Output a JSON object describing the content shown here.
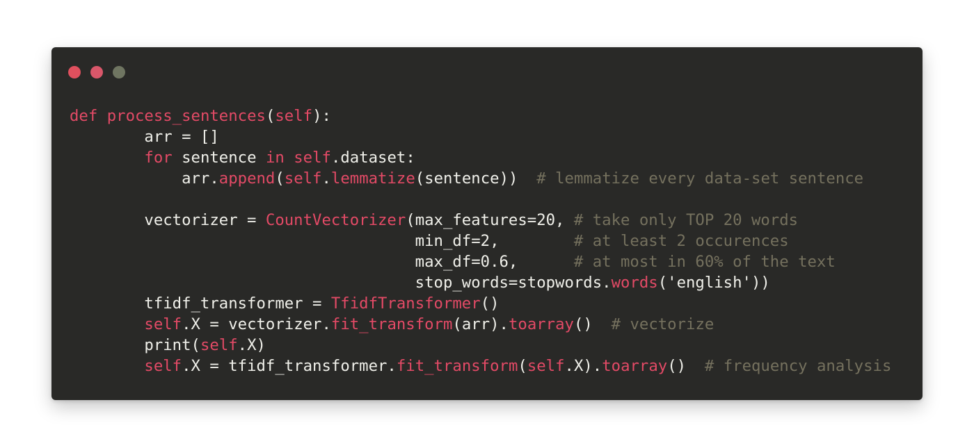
{
  "window": {
    "traffic_lights": [
      {
        "name": "close",
        "color": "#e0505e"
      },
      {
        "name": "minimize",
        "color": "#d9576a"
      },
      {
        "name": "maximize",
        "color": "#6f7561"
      }
    ]
  },
  "colors": {
    "background": "#292927",
    "plain": "#f0f0ea",
    "keyword": "#e34a66",
    "comment": "#75715e"
  },
  "code": {
    "lines": [
      [
        {
          "t": "def",
          "c": "keyword"
        },
        {
          "t": " ",
          "c": "plain"
        },
        {
          "t": "process_sentences",
          "c": "keyword"
        },
        {
          "t": "(",
          "c": "plain"
        },
        {
          "t": "self",
          "c": "keyword"
        },
        {
          "t": "):",
          "c": "plain"
        }
      ],
      [
        {
          "t": "        arr = []",
          "c": "plain"
        }
      ],
      [
        {
          "t": "        ",
          "c": "plain"
        },
        {
          "t": "for",
          "c": "keyword"
        },
        {
          "t": " sentence ",
          "c": "plain"
        },
        {
          "t": "in",
          "c": "keyword"
        },
        {
          "t": " ",
          "c": "plain"
        },
        {
          "t": "self",
          "c": "keyword"
        },
        {
          "t": ".dataset:",
          "c": "plain"
        }
      ],
      [
        {
          "t": "            arr.",
          "c": "plain"
        },
        {
          "t": "append",
          "c": "keyword"
        },
        {
          "t": "(",
          "c": "plain"
        },
        {
          "t": "self",
          "c": "keyword"
        },
        {
          "t": ".",
          "c": "plain"
        },
        {
          "t": "lemmatize",
          "c": "keyword"
        },
        {
          "t": "(sentence))  ",
          "c": "plain"
        },
        {
          "t": "# lemmatize every data-set sentence",
          "c": "comment"
        }
      ],
      [],
      [
        {
          "t": "        vectorizer = ",
          "c": "plain"
        },
        {
          "t": "CountVectorizer",
          "c": "keyword"
        },
        {
          "t": "(max_features=20, ",
          "c": "plain"
        },
        {
          "t": "# take only TOP 20 words",
          "c": "comment"
        }
      ],
      [
        {
          "t": "                                     min_df=2,        ",
          "c": "plain"
        },
        {
          "t": "# at least 2 occurences",
          "c": "comment"
        }
      ],
      [
        {
          "t": "                                     max_df=0.6,      ",
          "c": "plain"
        },
        {
          "t": "# at most in 60% of the text",
          "c": "comment"
        }
      ],
      [
        {
          "t": "                                     stop_words=stopwords.",
          "c": "plain"
        },
        {
          "t": "words",
          "c": "keyword"
        },
        {
          "t": "('english'))",
          "c": "plain"
        }
      ],
      [
        {
          "t": "        tfidf_transformer = ",
          "c": "plain"
        },
        {
          "t": "TfidfTransformer",
          "c": "keyword"
        },
        {
          "t": "()",
          "c": "plain"
        }
      ],
      [
        {
          "t": "        ",
          "c": "plain"
        },
        {
          "t": "self",
          "c": "keyword"
        },
        {
          "t": ".X = vectorizer.",
          "c": "plain"
        },
        {
          "t": "fit_transform",
          "c": "keyword"
        },
        {
          "t": "(arr).",
          "c": "plain"
        },
        {
          "t": "toarray",
          "c": "keyword"
        },
        {
          "t": "()  ",
          "c": "plain"
        },
        {
          "t": "# vectorize",
          "c": "comment"
        }
      ],
      [
        {
          "t": "        ",
          "c": "plain"
        },
        {
          "t": "print",
          "c": "plain"
        },
        {
          "t": "(",
          "c": "plain"
        },
        {
          "t": "self",
          "c": "keyword"
        },
        {
          "t": ".X)",
          "c": "plain"
        }
      ],
      [
        {
          "t": "        ",
          "c": "plain"
        },
        {
          "t": "self",
          "c": "keyword"
        },
        {
          "t": ".X = tfidf_transformer.",
          "c": "plain"
        },
        {
          "t": "fit_transform",
          "c": "keyword"
        },
        {
          "t": "(",
          "c": "plain"
        },
        {
          "t": "self",
          "c": "keyword"
        },
        {
          "t": ".X).",
          "c": "plain"
        },
        {
          "t": "toarray",
          "c": "keyword"
        },
        {
          "t": "()  ",
          "c": "plain"
        },
        {
          "t": "# frequency analysis",
          "c": "comment"
        }
      ]
    ]
  }
}
